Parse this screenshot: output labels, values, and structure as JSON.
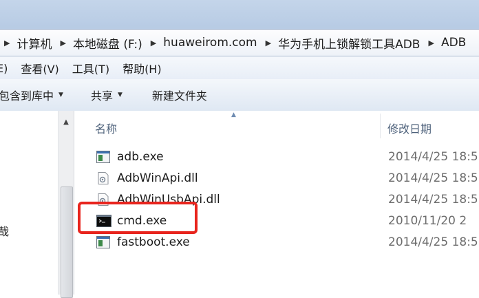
{
  "address": {
    "crumbs": [
      "计算机",
      "本地磁盘 (F:)",
      "huaweirom.com",
      "华为手机上锁解锁工具ADB",
      "ADB"
    ]
  },
  "menu": {
    "items": [
      "E)",
      "查看(V)",
      "工具(T)",
      "帮助(H)"
    ]
  },
  "toolbar": {
    "include_library": "包含到库中",
    "share": "共享",
    "new_folder": "新建文件夹"
  },
  "nav": {
    "partial_label": "哉"
  },
  "columns": {
    "name": "名称",
    "date_modified": "修改日期"
  },
  "files": [
    {
      "name": "adb.exe",
      "date": "2014/4/25 18:5",
      "type": "exe"
    },
    {
      "name": "AdbWinApi.dll",
      "date": "2014/4/25 18:5",
      "type": "dll"
    },
    {
      "name": "AdbWinUsbApi.dll",
      "date": "2014/4/25 18:5",
      "type": "dll"
    },
    {
      "name": "cmd.exe",
      "date": "2010/11/20 2",
      "type": "cmd"
    },
    {
      "name": "fastboot.exe",
      "date": "2014/4/25 18:5",
      "type": "exe"
    }
  ],
  "colors": {
    "highlight": "#e8241d",
    "titlebar": "#c4d5ea"
  }
}
